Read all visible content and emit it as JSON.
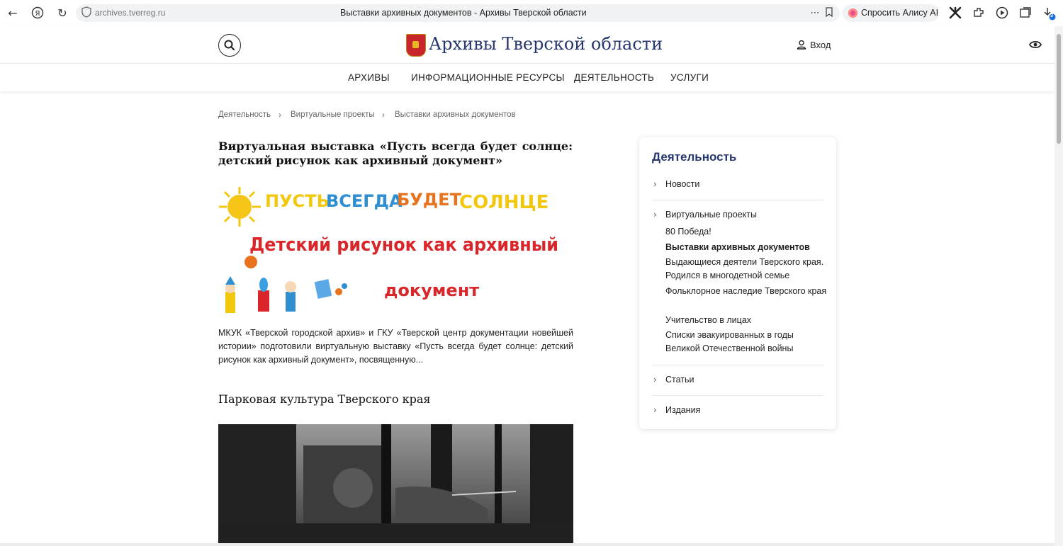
{
  "browser": {
    "url": "archives.tverreg.ru",
    "tab_title": "Выставки архивных документов - Архивы Тверской области",
    "alice_label": "Спросить Алису AI",
    "download_badge": "3"
  },
  "header": {
    "site_title": "Архивы Тверской области",
    "login_label": "Вход"
  },
  "nav": {
    "items": [
      "АРХИВЫ",
      "ИНФОРМАЦИОННЫЕ РЕСУРСЫ",
      "ДЕЯТЕЛЬНОСТЬ",
      "УСЛУГИ"
    ]
  },
  "breadcrumb": [
    "Деятельность",
    "Виртуальные проекты",
    "Выставки архивных документов"
  ],
  "articles": [
    {
      "title": "Виртуальная выставка «Пусть всегда будет солнце: детский рисунок как архивный документ»",
      "banner": {
        "words_line1": [
          "ПУСТЬ",
          "ВСЕГДА",
          "БУДЕТ",
          "СОЛНЦЕ"
        ],
        "line2": "Детский рисунок как архивный",
        "line3": "документ"
      },
      "excerpt": "МКУК «Тверской городской архив» и ГКУ «Тверской центр документации новейшей истории» подготовили виртуальную выставку «Пусть всегда будет солнце: детский рисунок как архивный документ», посвященную..."
    },
    {
      "title": "Парковая культура Тверского края"
    }
  ],
  "sidebar": {
    "title": "Деятельность",
    "items": [
      {
        "label": "Новости"
      },
      {
        "label": "Виртуальные проекты",
        "children": [
          "80 Победа!",
          "Выставки архивных документов",
          "Выдающиеся деятели Тверского края. Родился в многодетной семье",
          "Фольклорное наследие Тверского края",
          "Учительство в лицах",
          "Списки эвакуированных в годы Великой Отечественной войны"
        ]
      },
      {
        "label": "Статьи"
      },
      {
        "label": "Издания"
      }
    ]
  },
  "colors": {
    "brand_blue": "#273870",
    "banner_yellow": "#f2c80f",
    "banner_blue": "#2f8fd0",
    "banner_orange": "#e8731e",
    "banner_red": "#d9262b"
  }
}
